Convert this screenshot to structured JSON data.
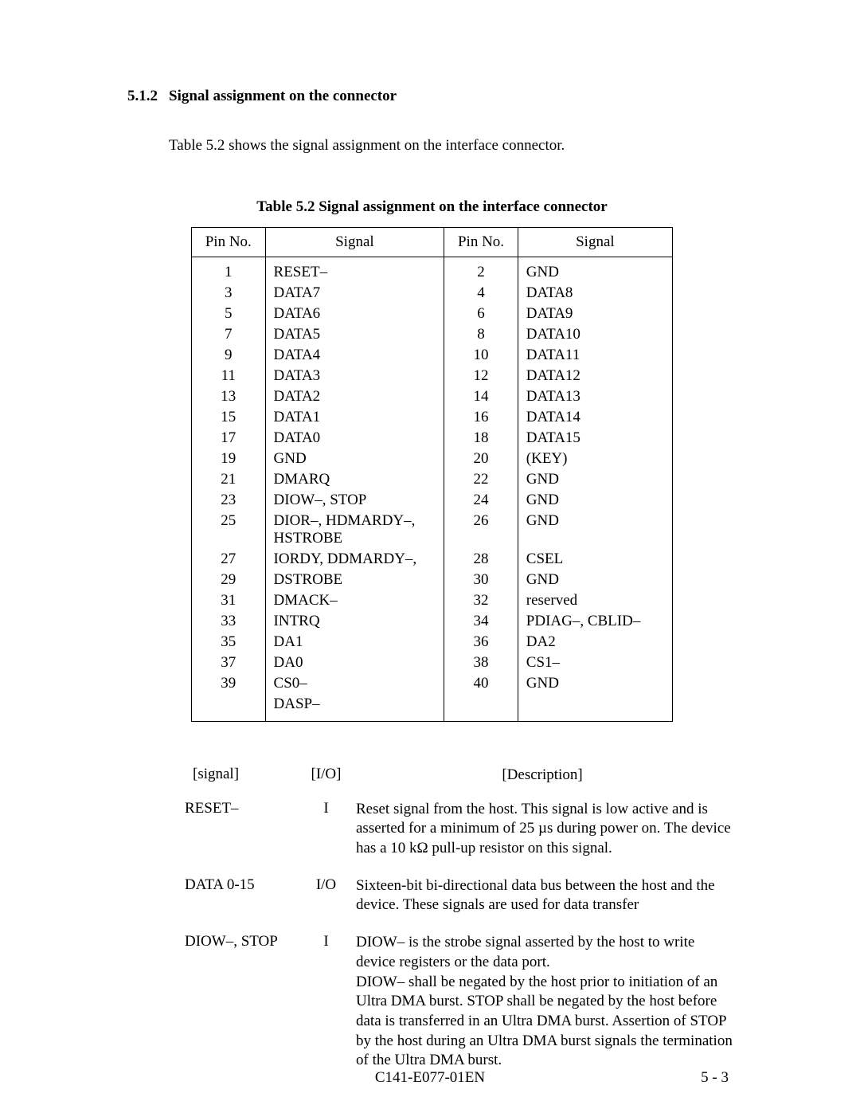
{
  "heading": {
    "number": "5.1.2",
    "title": "Signal assignment on the connector"
  },
  "intro": "Table 5.2 shows the signal assignment on the interface connector.",
  "table_caption": "Table 5.2    Signal assignment on the interface connector",
  "pin_headers": {
    "pin": "Pin No.",
    "signal": "Signal"
  },
  "pin_rows": [
    {
      "l_pin": "1",
      "l_sig": "RESET–",
      "r_pin": "2",
      "r_sig": "GND"
    },
    {
      "l_pin": "3",
      "l_sig": "DATA7",
      "r_pin": "4",
      "r_sig": "DATA8"
    },
    {
      "l_pin": "5",
      "l_sig": "DATA6",
      "r_pin": "6",
      "r_sig": "DATA9"
    },
    {
      "l_pin": "7",
      "l_sig": "DATA5",
      "r_pin": "8",
      "r_sig": "DATA10"
    },
    {
      "l_pin": "9",
      "l_sig": "DATA4",
      "r_pin": "10",
      "r_sig": "DATA11"
    },
    {
      "l_pin": "11",
      "l_sig": "DATA3",
      "r_pin": "12",
      "r_sig": "DATA12"
    },
    {
      "l_pin": "13",
      "l_sig": "DATA2",
      "r_pin": "14",
      "r_sig": "DATA13"
    },
    {
      "l_pin": "15",
      "l_sig": "DATA1",
      "r_pin": "16",
      "r_sig": "DATA14"
    },
    {
      "l_pin": "17",
      "l_sig": "DATA0",
      "r_pin": "18",
      "r_sig": "DATA15"
    },
    {
      "l_pin": "19",
      "l_sig": "GND",
      "r_pin": "20",
      "r_sig": "(KEY)"
    },
    {
      "l_pin": "21",
      "l_sig": "DMARQ",
      "r_pin": "22",
      "r_sig": "GND"
    },
    {
      "l_pin": "23",
      "l_sig": "DIOW–, STOP",
      "r_pin": "24",
      "r_sig": "GND"
    },
    {
      "l_pin": "25",
      "l_sig": "DIOR–, HDMARDY–, HSTROBE",
      "r_pin": "26",
      "r_sig": "GND"
    },
    {
      "l_pin": "27",
      "l_sig": "IORDY, DDMARDY–,",
      "r_pin": "28",
      "r_sig": "CSEL"
    },
    {
      "l_pin": "29",
      "l_sig": "DSTROBE",
      "r_pin": "30",
      "r_sig": "GND"
    },
    {
      "l_pin": "31",
      "l_sig": "DMACK–",
      "r_pin": "32",
      "r_sig": "reserved"
    },
    {
      "l_pin": "33",
      "l_sig": "INTRQ",
      "r_pin": "34",
      "r_sig": "PDIAG–, CBLID–"
    },
    {
      "l_pin": "35",
      "l_sig": "DA1",
      "r_pin": "36",
      "r_sig": "DA2"
    },
    {
      "l_pin": "37",
      "l_sig": "DA0",
      "r_pin": "38",
      "r_sig": "CS1–"
    },
    {
      "l_pin": "39",
      "l_sig": "CS0–",
      "r_pin": "40",
      "r_sig": "GND"
    },
    {
      "l_pin": "",
      "l_sig": "DASP–",
      "r_pin": "",
      "r_sig": ""
    }
  ],
  "desc_headers": {
    "signal": "[signal]",
    "io": "[I/O]",
    "desc": "[Description]"
  },
  "desc_rows": [
    {
      "signal": "RESET–",
      "io": "I",
      "text": "Reset signal from the host.  This signal is low active and is asserted for a minimum of 25 µs during power on.  The device has a 10 kΩ pull-up resistor on this signal."
    },
    {
      "signal": "DATA 0-15",
      "io": "I/O",
      "text": "Sixteen-bit bi-directional data bus between the host and the device. These signals are used for data transfer"
    },
    {
      "signal": "DIOW–, STOP",
      "io": "I",
      "text": "DIOW– is the strobe signal asserted by the host to write device registers or the data port.\nDIOW– shall be negated by the host prior to initiation of an Ultra DMA burst.  STOP shall be negated by the host before data is transferred in an Ultra DMA burst.  Assertion of STOP by the host during an Ultra DMA burst signals the termination of the Ultra DMA burst."
    }
  ],
  "footer": {
    "doc": "C141-E077-01EN",
    "page": "5 - 3"
  }
}
